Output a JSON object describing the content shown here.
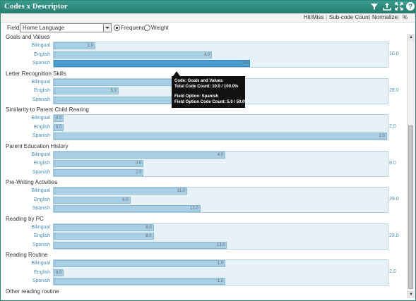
{
  "window": {
    "title": "Codes x Descriptor",
    "icons": [
      "filter-icon",
      "export-icon",
      "expand-icon",
      "help-icon"
    ]
  },
  "toolbar": {
    "hitmiss": "Hit/Miss",
    "subcode_count": "Sub-code Count",
    "normalize": "Normalize",
    "percent": "%"
  },
  "field": {
    "label": "Field:",
    "selected": "Home Language",
    "frequency": "Frequency",
    "weight": "Weight",
    "mode": "Frequency"
  },
  "colors": {
    "accent": "#2f8a7e",
    "bar": "#a8cfe4",
    "bar_selected": "#4a9fd0",
    "panel": "#e6f1f8"
  },
  "sections": [
    {
      "title": "Goals and Values",
      "total": "10.0",
      "rows": [
        {
          "label": "Bilingual",
          "value": "1.0",
          "frac": 0.125
        },
        {
          "label": "English",
          "value": "4.0",
          "frac": 0.475
        },
        {
          "label": "Spanish",
          "value": "5.0",
          "frac": 0.59,
          "selected": true
        }
      ]
    },
    {
      "title": "Letter Recognition Skills",
      "total": "28.0",
      "rows": [
        {
          "label": "Bilingual",
          "value": "",
          "frac": 0.36
        },
        {
          "label": "English",
          "value": "5.0",
          "frac": 0.195
        },
        {
          "label": "Spanish",
          "value": "",
          "frac": 0.36
        }
      ]
    },
    {
      "title": "Similarity to Parent Child Rearing",
      "total": "2.0",
      "rows": [
        {
          "label": "Bilingual",
          "value": "0.0",
          "frac": 0.03
        },
        {
          "label": "English",
          "value": "0.0",
          "frac": 0.03
        },
        {
          "label": "Spanish",
          "value": "2.0",
          "frac": 1.0
        }
      ]
    },
    {
      "title": "Parent Education History",
      "total": "8.0",
      "rows": [
        {
          "label": "Bilingual",
          "value": "4.0",
          "frac": 0.515
        },
        {
          "label": "English",
          "value": "2.0",
          "frac": 0.27
        },
        {
          "label": "Spanish",
          "value": "2.0",
          "frac": 0.27
        }
      ]
    },
    {
      "title": "Pre-Writing Activities",
      "total": "29.0",
      "rows": [
        {
          "label": "Bilingual",
          "value": "11.0",
          "frac": 0.4
        },
        {
          "label": "English",
          "value": "6.0",
          "frac": 0.23
        },
        {
          "label": "Spanish",
          "value": "12.0",
          "frac": 0.44
        }
      ]
    },
    {
      "title": "Reading by PC",
      "total": "29.0",
      "rows": [
        {
          "label": "Bilingual",
          "value": "8.0",
          "frac": 0.3
        },
        {
          "label": "English",
          "value": "8.0",
          "frac": 0.3
        },
        {
          "label": "Spanish",
          "value": "13.0",
          "frac": 0.52
        }
      ]
    },
    {
      "title": "Reading Routine",
      "total": "2.0",
      "rows": [
        {
          "label": "Bilingual",
          "value": "1.0",
          "frac": 0.515
        },
        {
          "label": "English",
          "value": "0.0",
          "frac": 0.03
        },
        {
          "label": "Spanish",
          "value": "1.0",
          "frac": 0.515
        }
      ]
    },
    {
      "title": "Other reading routine",
      "total": "",
      "rows": []
    }
  ],
  "tooltip": {
    "code": "Code: Goals and Values",
    "total": "Total Code Count: 10.0 / 100.0%",
    "field_option": "Field Option: Spanish",
    "field_count": "Field Option Code Count: 5.0 / 50.0%"
  }
}
